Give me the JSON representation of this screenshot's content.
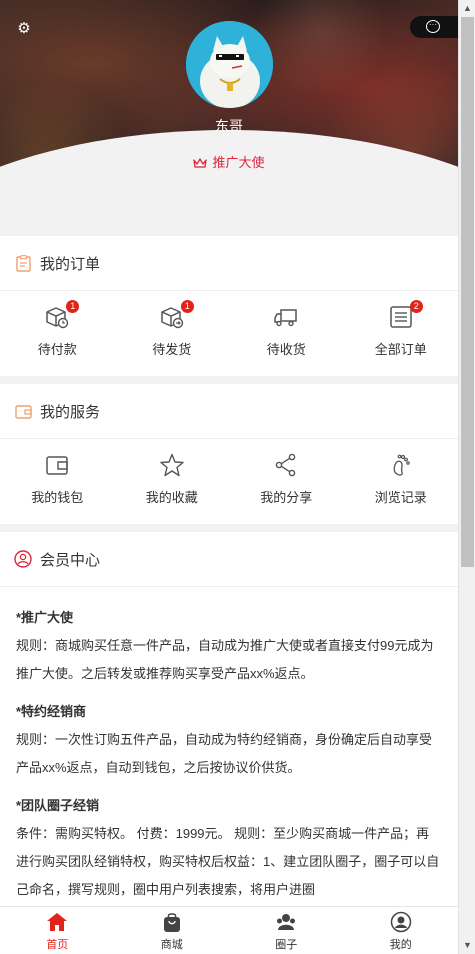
{
  "profile": {
    "nickname": "东哥",
    "role": "推广大使",
    "accent_color": "#e0243a"
  },
  "header_icons": {
    "settings": "gear-icon",
    "messages": "chat-bubble-icon"
  },
  "orders": {
    "title": "我的订单",
    "items": [
      {
        "label": "待付款",
        "icon": "box-clock-icon",
        "badge": "1"
      },
      {
        "label": "待发货",
        "icon": "box-send-icon",
        "badge": "1"
      },
      {
        "label": "待收货",
        "icon": "truck-icon",
        "badge": ""
      },
      {
        "label": "全部订单",
        "icon": "list-icon",
        "badge": "2"
      }
    ]
  },
  "services": {
    "title": "我的服务",
    "items": [
      {
        "label": "我的钱包",
        "icon": "wallet-icon"
      },
      {
        "label": "我的收藏",
        "icon": "star-icon"
      },
      {
        "label": "我的分享",
        "icon": "share-icon"
      },
      {
        "label": "浏览记录",
        "icon": "footprint-icon"
      }
    ]
  },
  "member": {
    "title": "会员中心",
    "sections": [
      {
        "title": "*推广大使",
        "text": "规则：商城购买任意一件产品，自动成为推广大使或者直接支付99元成为推广大使。之后转发或推荐购买享受产品xx%返点。"
      },
      {
        "title": "*特约经销商",
        "text": "规则：一次性订购五件产品，自动成为特约经销商，身份确定后自动享受产品xx%返点，自动到钱包，之后按协议价供货。"
      },
      {
        "title": "*团队圈子经销",
        "text": "条件：需购买特权。 付费：1999元。 规则：至少购买商城一件产品；再进行购买团队经销特权，购买特权后权益：1、建立团队圈子，圈子可以自己命名，撰写规则，圈中用户列表搜索，将用户进圈"
      }
    ]
  },
  "tabbar": {
    "items": [
      {
        "label": "首页",
        "icon": "home-icon",
        "active": true
      },
      {
        "label": "商城",
        "icon": "shopping-bag-icon",
        "active": false
      },
      {
        "label": "圈子",
        "icon": "group-icon",
        "active": false
      },
      {
        "label": "我的",
        "icon": "user-icon",
        "active": false
      }
    ],
    "active_color": "#e2231a"
  }
}
